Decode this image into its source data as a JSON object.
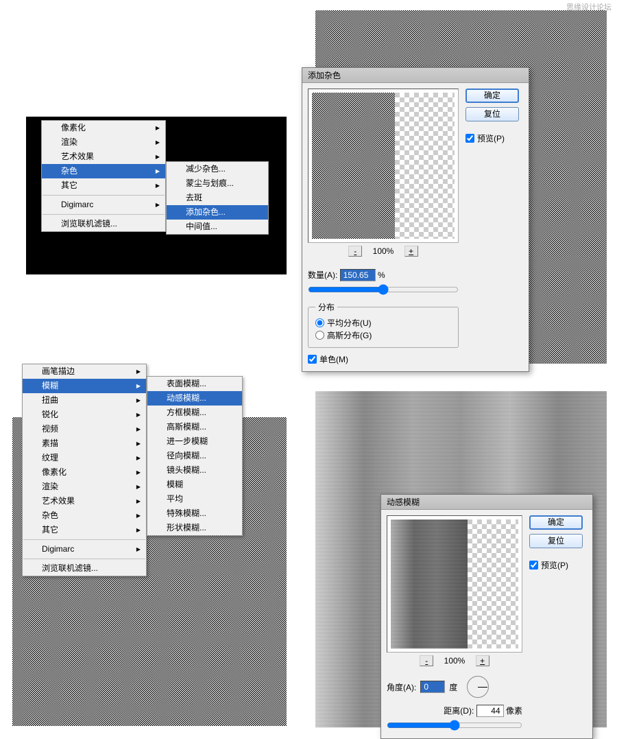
{
  "watermark": "思缘设计论坛",
  "menu1": {
    "items": [
      "像素化",
      "渲染",
      "艺术效果",
      "杂色",
      "其它"
    ],
    "selectedIndex": 3,
    "digimarc": "Digimarc",
    "browse": "浏览联机滤镜..."
  },
  "submenu1": {
    "items": [
      "减少杂色...",
      "蒙尘与划痕...",
      "去斑",
      "添加杂色...",
      "中间值..."
    ],
    "selectedIndex": 3
  },
  "dialog_noise": {
    "title": "添加杂色",
    "ok": "确定",
    "reset": "复位",
    "preview": "预览(P)",
    "zoom": "100%",
    "amount_label": "数量(A):",
    "amount_value": "150.65",
    "amount_unit": "%",
    "dist_legend": "分布",
    "uniform": "平均分布(U)",
    "gaussian": "高斯分布(G)",
    "mono": "单色(M)"
  },
  "menu2": {
    "items": [
      "画笔描边",
      "模糊",
      "扭曲",
      "锐化",
      "视频",
      "素描",
      "纹理",
      "像素化",
      "渲染",
      "艺术效果",
      "杂色",
      "其它"
    ],
    "selectedIndex": 1,
    "digimarc": "Digimarc",
    "browse": "浏览联机滤镜..."
  },
  "submenu2": {
    "items": [
      "表面模糊...",
      "动感模糊...",
      "方框模糊...",
      "高斯模糊...",
      "进一步模糊",
      "径向模糊...",
      "镜头模糊...",
      "模糊",
      "平均",
      "特殊模糊...",
      "形状模糊..."
    ],
    "selectedIndex": 1
  },
  "dialog_motion": {
    "title": "动感模糊",
    "ok": "确定",
    "reset": "复位",
    "preview": "预览(P)",
    "zoom": "100%",
    "angle_label": "角度(A):",
    "angle_value": "0",
    "angle_unit": "度",
    "dist_label": "距离(D):",
    "dist_value": "44",
    "dist_unit": "像素"
  }
}
